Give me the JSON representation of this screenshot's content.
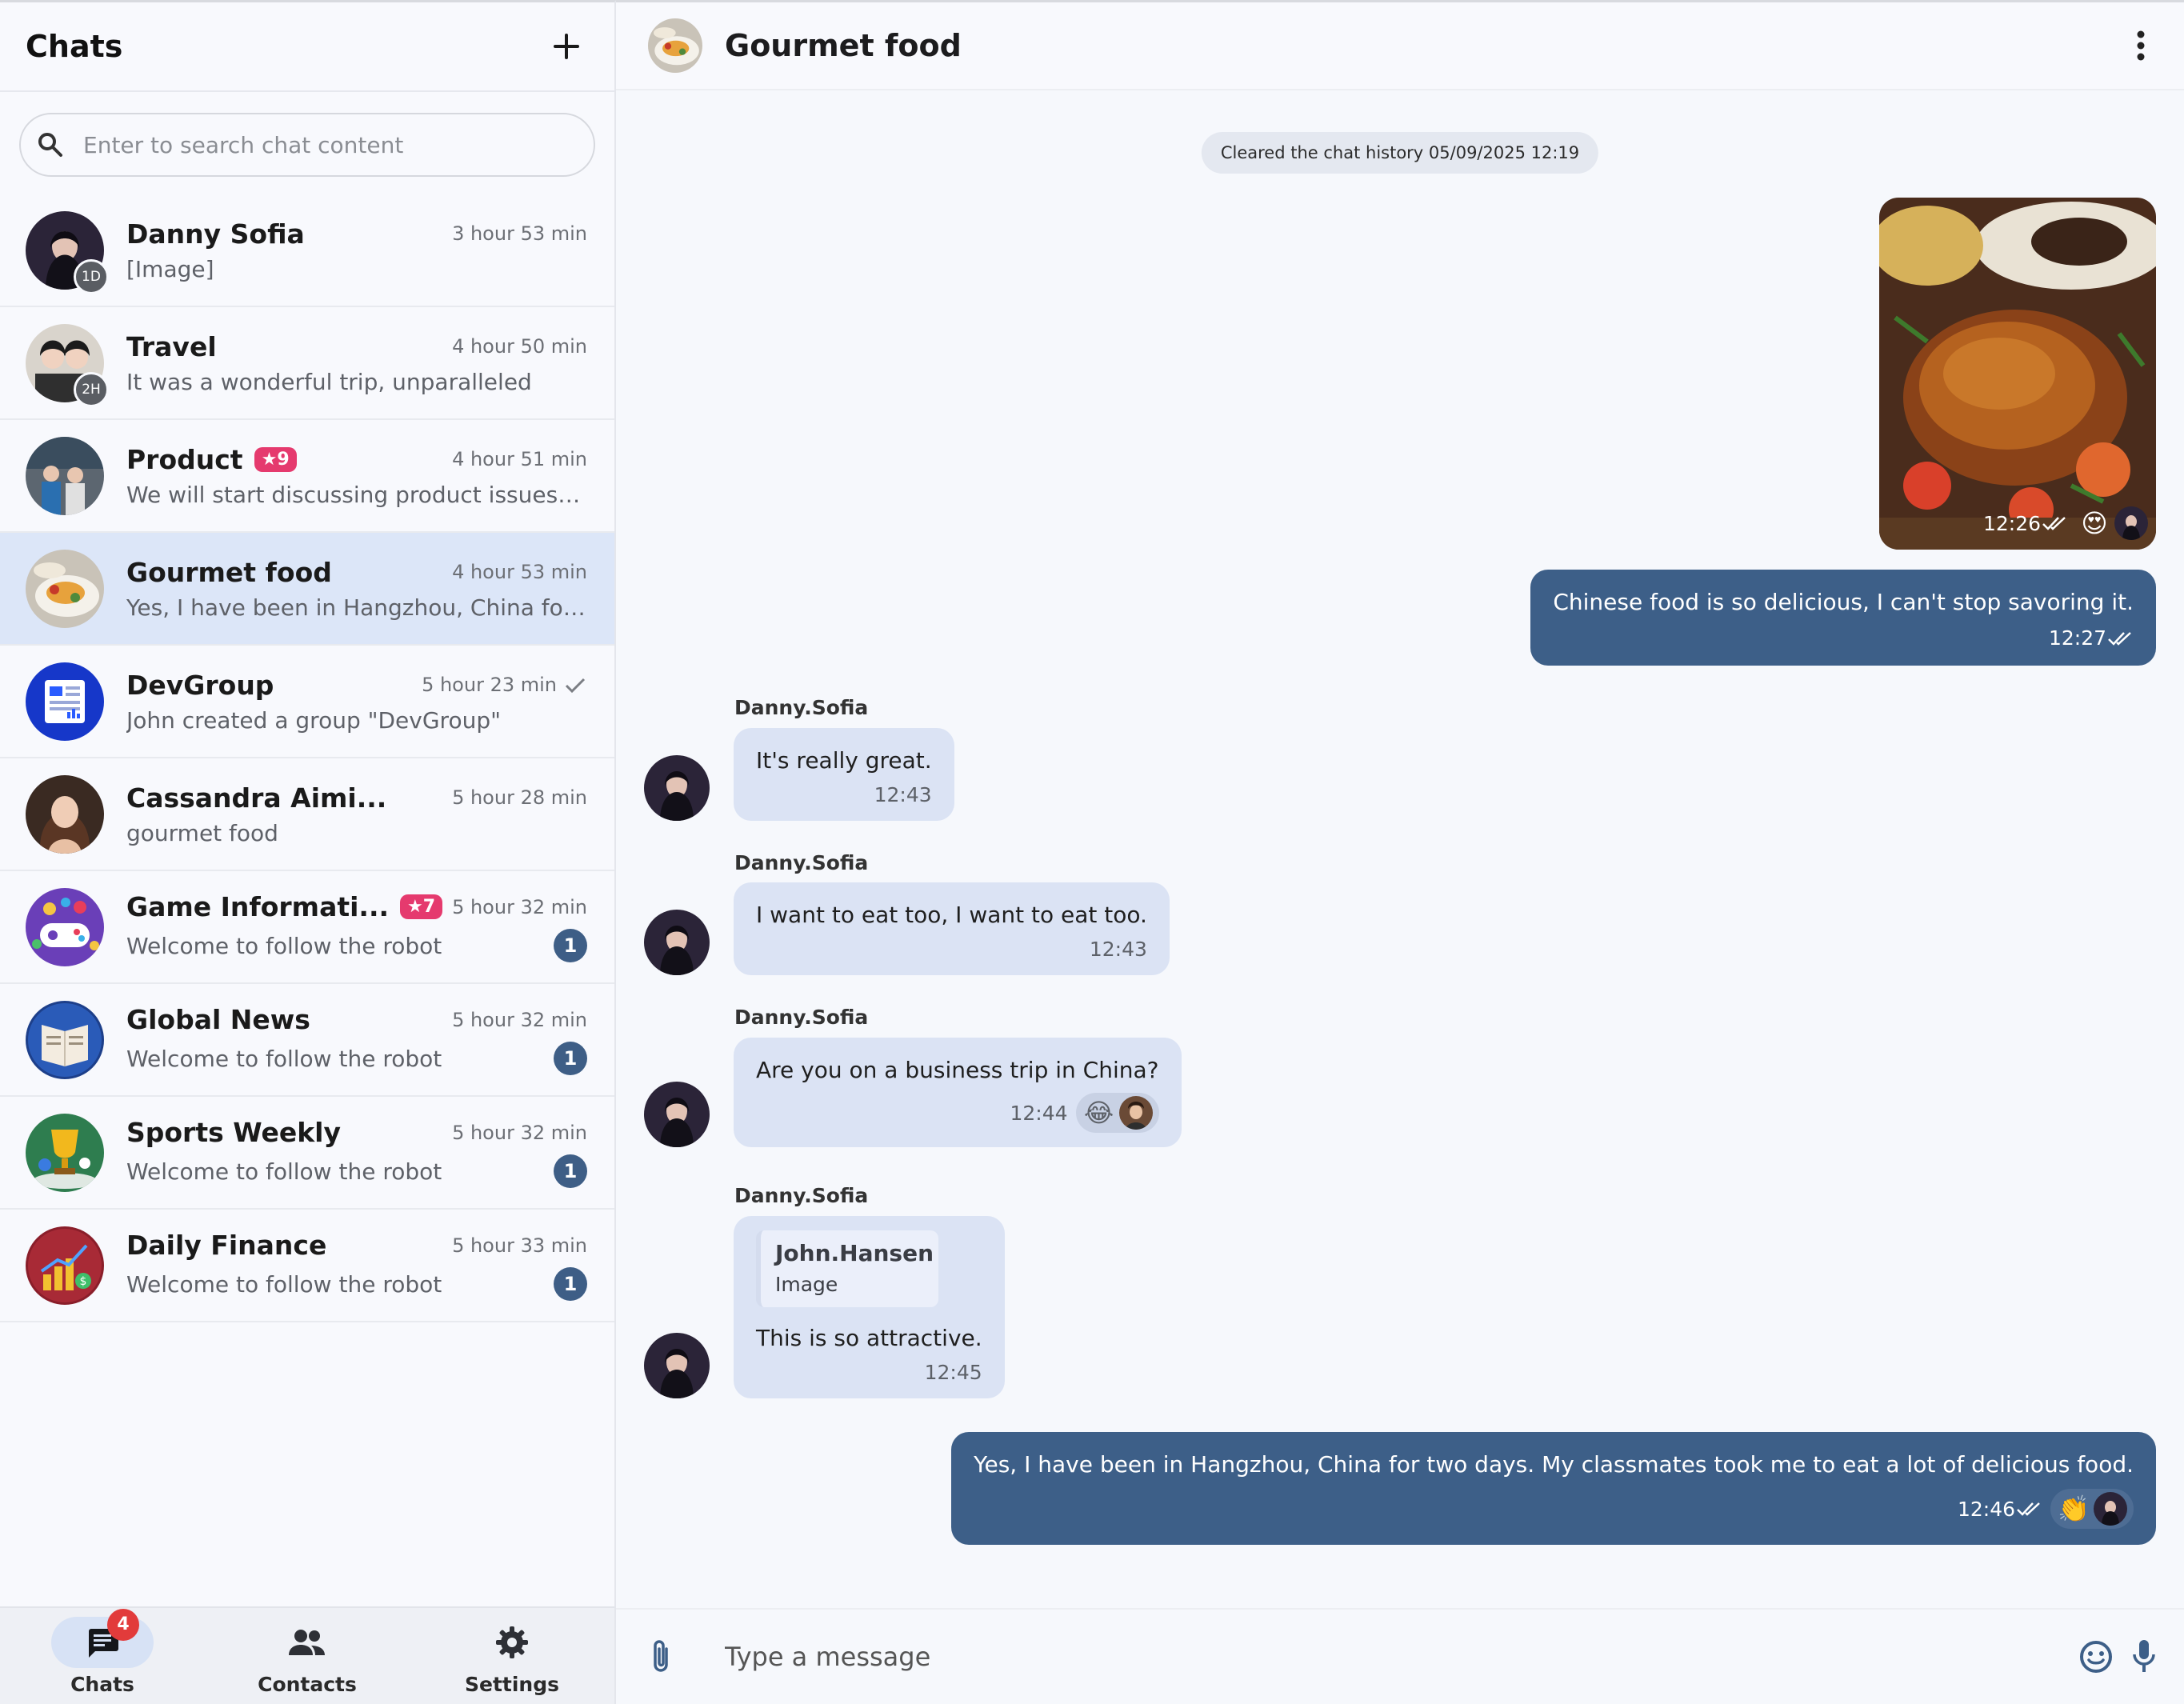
{
  "sidebar": {
    "title": "Chats",
    "search": {
      "placeholder": "Enter to search chat content"
    },
    "chats": [
      {
        "name": "Danny Sofia",
        "time": "3 hour 53 min",
        "preview": "[Image]",
        "status": "1D"
      },
      {
        "name": "Travel",
        "time": "4 hour 50 min",
        "preview": "It was a wonderful trip, unparalleled",
        "status": "2H"
      },
      {
        "name": "Product",
        "badge": "★9",
        "time": "4 hour 51 min",
        "preview": "We will start discussing product issues t..."
      },
      {
        "name": "Gourmet food",
        "time": "4 hour 53 min",
        "preview": "Yes, I have been in Hangzhou, China for ..."
      },
      {
        "name": "DevGroup",
        "time": "5 hour 23 min",
        "preview": "John created a group \"DevGroup\""
      },
      {
        "name": "Cassandra Aimi...",
        "time": "5 hour 28 min",
        "preview": "gourmet food"
      },
      {
        "name": "Game Informati...",
        "badge": "★7",
        "time": "5 hour 32 min",
        "preview": "Welcome to follow the robot",
        "unread": "1"
      },
      {
        "name": "Global News",
        "time": "5 hour 32 min",
        "preview": "Welcome to follow the robot",
        "unread": "1"
      },
      {
        "name": "Sports Weekly",
        "time": "5 hour 32 min",
        "preview": "Welcome to follow the robot",
        "unread": "1"
      },
      {
        "name": "Daily Finance",
        "time": "5 hour 33 min",
        "preview": "Welcome to follow the robot",
        "unread": "1"
      }
    ]
  },
  "nav": {
    "chats": "Chats",
    "chats_badge": "4",
    "contacts": "Contacts",
    "settings": "Settings"
  },
  "conversation": {
    "title": "Gourmet food",
    "system_message": "Cleared the chat history 05/09/2025 12:19",
    "image_message": {
      "time": "12:26",
      "reaction": "😍"
    },
    "messages": [
      {
        "text": "Chinese food is so delicious, I can't stop savoring it.",
        "time": "12:27"
      },
      {
        "sender": "Danny.Sofia",
        "text": "It's really great.",
        "time": "12:43"
      },
      {
        "sender": "Danny.Sofia",
        "text": "I want to eat too, I want to eat too.",
        "time": "12:43"
      },
      {
        "sender": "Danny.Sofia",
        "text": "Are you on a business trip in China?",
        "time": "12:44",
        "reaction": "😂"
      },
      {
        "sender": "Danny.Sofia",
        "quote_name": "John.Hansen",
        "quote_text": "Image",
        "text": "This is so attractive.",
        "time": "12:45"
      },
      {
        "text": "Yes, I have been in Hangzhou, China for two days. My classmates took me to eat a lot of delicious food.",
        "time": "12:46",
        "reaction": "👏"
      }
    ],
    "composer_placeholder": "Type a message"
  }
}
